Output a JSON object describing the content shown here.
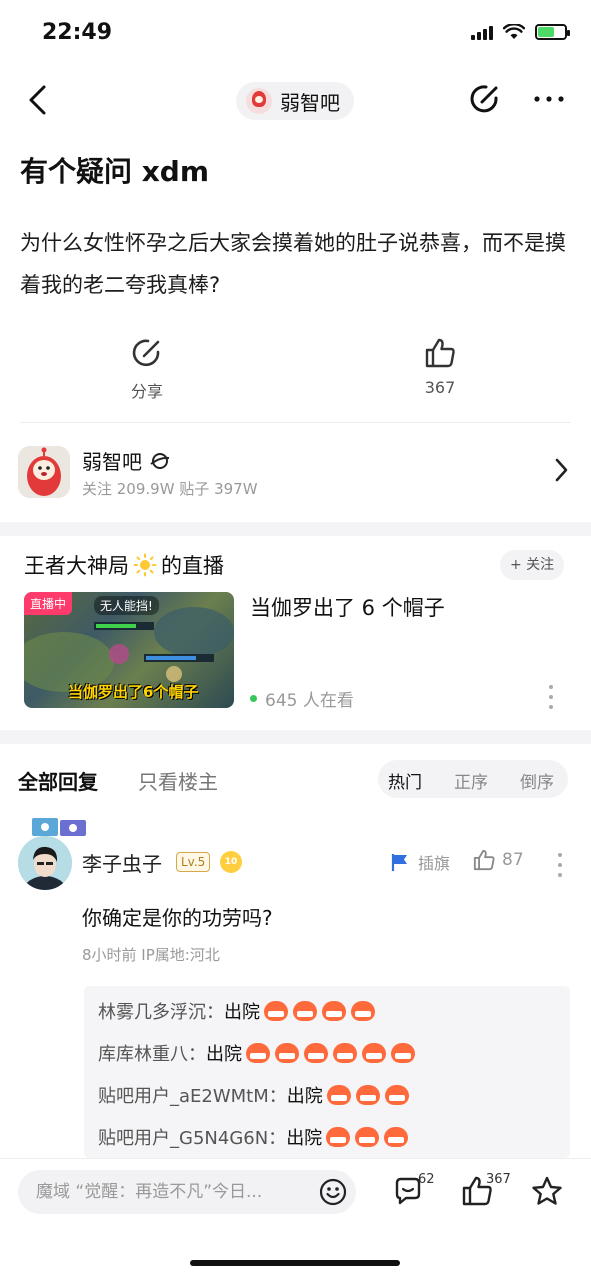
{
  "status_bar": {
    "time": "22:49"
  },
  "nav": {
    "forum_chip": "弱智吧"
  },
  "post": {
    "title": "有个疑问 xdm",
    "body": "为什么女性怀孕之后大家会摸着她的肚子说恭喜，而不是摸着我的老二夸我真棒?",
    "share_label": "分享",
    "like_count": "367"
  },
  "forum": {
    "name": "弱智吧",
    "stats": "关注 209.9W  贴子 397W"
  },
  "live": {
    "title_prefix": "王者大神局",
    "title_suffix": "的直播",
    "follow_label": "+ 关注",
    "badge": "直播中",
    "thumb_top_text": "无人能挡!",
    "thumb_caption": "当伽罗出了6个帽子",
    "headline": "当伽罗出了 6 个帽子",
    "viewers": "645 人在看"
  },
  "replies": {
    "tab_all": "全部回复",
    "tab_op": "只看楼主",
    "sort": {
      "hot": "热门",
      "asc": "正序",
      "desc": "倒序"
    }
  },
  "comment": {
    "user": "李子虫子",
    "level": "Lv.5",
    "coin": "10",
    "flag_label": "插旗",
    "likes": "87",
    "text": "你确定是你的功劳吗?",
    "meta": "8小时前  IP属地:河北",
    "sub_replies": [
      {
        "user": "林雾几多浮沉：",
        "text": "出院",
        "emojis": 4
      },
      {
        "user": "库库林重八：",
        "text": "出院",
        "emojis": 6
      },
      {
        "user": "贴吧用户_aE2WMtM：",
        "text": "出院",
        "emojis": 3
      },
      {
        "user": "贴吧用户_G5N4G6N：",
        "text": "出院",
        "emojis": 3
      }
    ]
  },
  "bottom": {
    "input_placeholder": "魔域 “觉醒：再造不凡”今日...",
    "comment_count": "62",
    "like_count": "367"
  },
  "colors": {
    "live_badge": "#ff3b6b",
    "level_gold": "#b07f20",
    "emoji_orange": "#ff6a3d",
    "flag_blue": "#2f6fe0"
  }
}
